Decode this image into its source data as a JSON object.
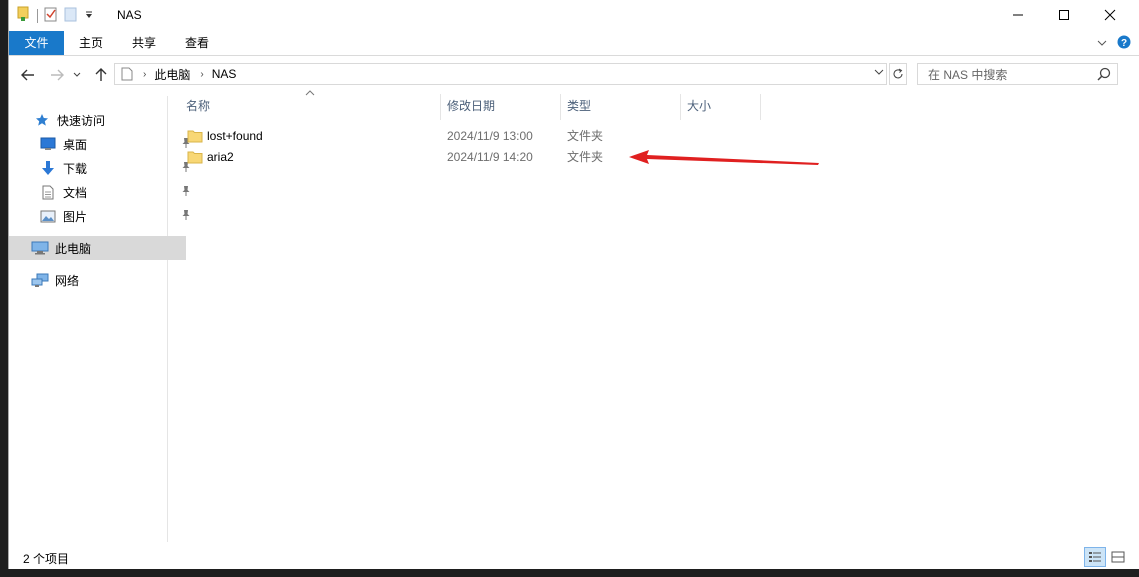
{
  "window": {
    "title": "NAS",
    "controls": {
      "minimize": "—",
      "maximize": "☐",
      "close": "✕"
    }
  },
  "ribbon": {
    "tabs": [
      "文件",
      "主页",
      "共享",
      "查看"
    ]
  },
  "address": {
    "crumbs": [
      "此电脑",
      "NAS"
    ],
    "search_placeholder": "在 NAS 中搜索"
  },
  "navpane": {
    "quick_access": "快速访问",
    "pinned": [
      "桌面",
      "下载",
      "文档",
      "图片"
    ],
    "this_pc": "此电脑",
    "network": "网络"
  },
  "columns": {
    "name": "名称",
    "date": "修改日期",
    "type": "类型",
    "size": "大小"
  },
  "files": [
    {
      "name": "lost+found",
      "date": "2024/11/9 13:00",
      "type": "文件夹"
    },
    {
      "name": "aria2",
      "date": "2024/11/9 14:20",
      "type": "文件夹"
    }
  ],
  "status": {
    "item_count": "2 个项目"
  },
  "colors": {
    "file_tab": "#1979ca",
    "annotation_arrow": "#e02020",
    "folder": "#f8d775"
  }
}
